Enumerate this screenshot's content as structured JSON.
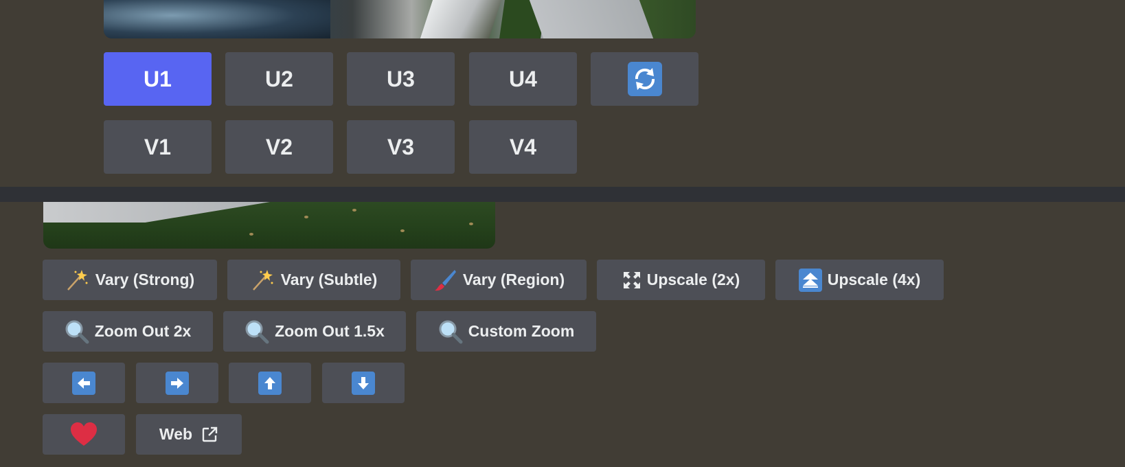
{
  "upscale_row": [
    {
      "label": "U1",
      "selected": true
    },
    {
      "label": "U2",
      "selected": false
    },
    {
      "label": "U3",
      "selected": false
    },
    {
      "label": "U4",
      "selected": false
    }
  ],
  "reroll": {
    "icon": "reroll-icon"
  },
  "variation_row": [
    {
      "label": "V1"
    },
    {
      "label": "V2"
    },
    {
      "label": "V3"
    },
    {
      "label": "V4"
    }
  ],
  "actions": {
    "vary_strong": "Vary (Strong)",
    "vary_subtle": "Vary (Subtle)",
    "vary_region": "Vary (Region)",
    "upscale_2x": "Upscale (2x)",
    "upscale_4x": "Upscale (4x)",
    "zoom_out_2x": "Zoom Out 2x",
    "zoom_out_1_5x": "Zoom Out 1.5x",
    "custom_zoom": "Custom Zoom",
    "pan_left": {
      "icon": "arrow-left-icon"
    },
    "pan_right": {
      "icon": "arrow-right-icon"
    },
    "pan_up": {
      "icon": "arrow-up-icon"
    },
    "pan_down": {
      "icon": "arrow-down-icon"
    },
    "favorite": {
      "icon": "heart-icon"
    },
    "web": "Web"
  },
  "colors": {
    "background": "#413d35",
    "button": "#4d4f56",
    "primary": "#5865f2",
    "separator": "#2f3136",
    "emoji_blue": "#4a87d0",
    "heart": "#dd2e44"
  }
}
